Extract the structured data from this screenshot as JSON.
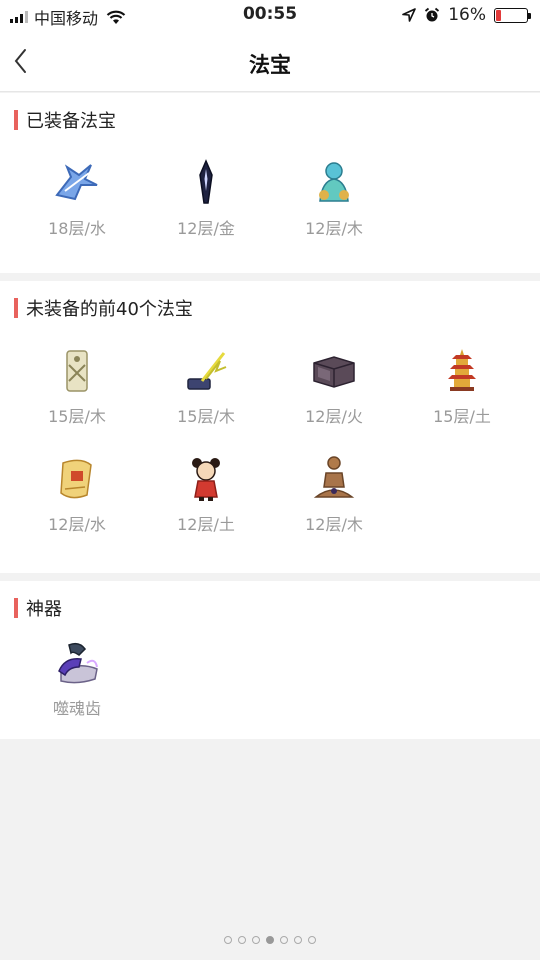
{
  "status_bar": {
    "carrier": "中国移动",
    "time": "00:55",
    "battery_text": "16%",
    "battery_level": 0.16
  },
  "nav": {
    "title": "法宝"
  },
  "sections": {
    "equipped": {
      "title": "已装备法宝",
      "items": [
        {
          "label": "18层/水",
          "icon": "blue-bird-icon"
        },
        {
          "label": "12层/金",
          "icon": "dark-blade-icon"
        },
        {
          "label": "12层/木",
          "icon": "blue-deity-icon"
        }
      ]
    },
    "unequipped": {
      "title": "未装备的前40个法宝",
      "items": [
        {
          "label": "15层/木",
          "icon": "paper-talisman-icon"
        },
        {
          "label": "15层/木",
          "icon": "lightning-sword-icon"
        },
        {
          "label": "12层/火",
          "icon": "dark-box-icon"
        },
        {
          "label": "15层/土",
          "icon": "pagoda-icon"
        },
        {
          "label": "12层/水",
          "icon": "scroll-icon"
        },
        {
          "label": "12层/土",
          "icon": "doll-icon"
        },
        {
          "label": "12层/木",
          "icon": "meditating-figure-icon"
        }
      ]
    },
    "artifact": {
      "title": "神器",
      "items": [
        {
          "label": "噬魂齿",
          "icon": "soul-tooth-icon"
        }
      ]
    }
  },
  "colors": {
    "accent": "#e8625d",
    "label_gray": "#9a9a9a",
    "page_bg": "#f2f2f2"
  },
  "pager": {
    "total": 7,
    "active": 4
  }
}
